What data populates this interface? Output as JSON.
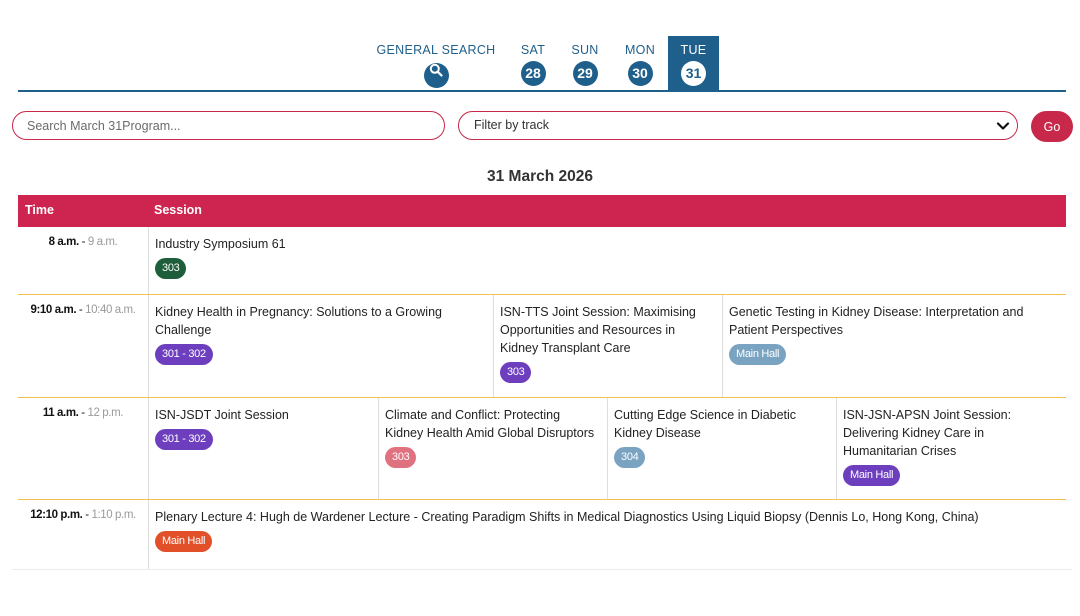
{
  "nav": {
    "general_search": "GENERAL SEARCH",
    "days": [
      {
        "label": "SAT",
        "num": "28"
      },
      {
        "label": "SUN",
        "num": "29"
      },
      {
        "label": "MON",
        "num": "30"
      },
      {
        "label": "TUE",
        "num": "31",
        "active": true
      }
    ],
    "accent": "#1f5f8b"
  },
  "search": {
    "placeholder": "Search March 31Program...",
    "value": "",
    "filter_label": "Filter by track",
    "go_label": "Go",
    "accent": "#c8284a"
  },
  "date_title": "31 March 2026",
  "table": {
    "header_time": "Time",
    "header_session": "Session",
    "header_color": "#cd2550",
    "rows": [
      {
        "time_start": "8 a.m.",
        "time_sep": " - ",
        "time_end": "9 a.m.",
        "sessions": [
          {
            "title": "Industry Symposium 61",
            "badge": "303",
            "badge_color": "#1e5e3a"
          }
        ]
      },
      {
        "time_start": "9:10 a.m.",
        "time_sep": " - ",
        "time_end": "10:40 a.m.",
        "sessions": [
          {
            "title": "Kidney Health in Pregnancy: Solutions to a Growing Challenge",
            "badge": "301 - 302",
            "badge_color": "#6d3fbf"
          },
          {
            "title": "ISN-TTS Joint Session: Maximising Opportunities and Resources in Kidney Transplant Care",
            "badge": "303",
            "badge_color": "#6d3fbf"
          },
          {
            "title": "Genetic Testing in Kidney Disease: Interpretation and Patient Perspectives",
            "badge": "Main Hall",
            "badge_color": "#7aa3c2"
          }
        ]
      },
      {
        "time_start": "11 a.m.",
        "time_sep": " - ",
        "time_end": "12 p.m.",
        "sessions": [
          {
            "title": "ISN-JSDT Joint Session",
            "badge": "301 - 302",
            "badge_color": "#6d3fbf"
          },
          {
            "title": "Climate and Conflict: Protecting Kidney Health Amid Global Disruptors",
            "badge": "303",
            "badge_color": "#e0727f"
          },
          {
            "title": "Cutting Edge Science in Diabetic Kidney Disease",
            "badge": "304",
            "badge_color": "#7aa3c2"
          },
          {
            "title": "ISN-JSN-APSN Joint Session: Delivering Kidney Care in Humanitarian Crises",
            "badge": "Main Hall",
            "badge_color": "#6d3fbf"
          }
        ]
      },
      {
        "time_start": "12:10 p.m.",
        "time_sep": " - ",
        "time_end": "1:10 p.m.",
        "sessions": [
          {
            "title": "Plenary Lecture 4: Hugh de Wardener Lecture - Creating Paradigm Shifts in Medical Diagnostics Using Liquid Biopsy (Dennis Lo, Hong Kong, China)",
            "badge": "Main Hall",
            "badge_color": "#e2502a"
          }
        ]
      }
    ]
  }
}
